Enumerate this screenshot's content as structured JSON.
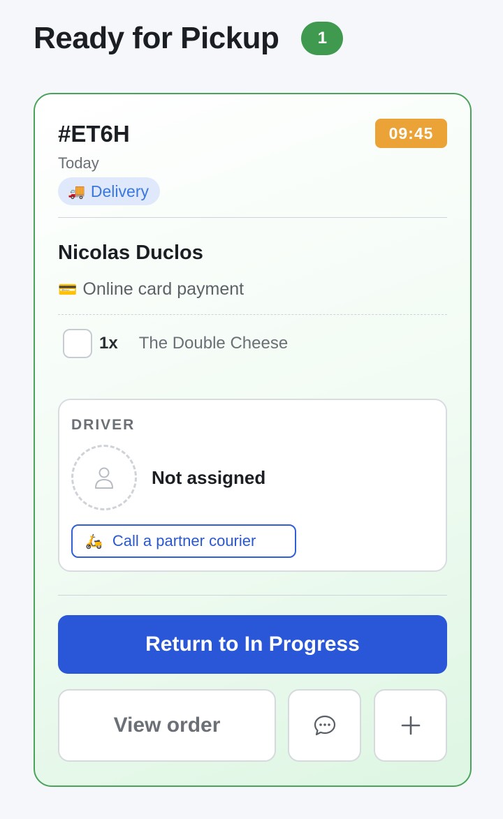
{
  "header": {
    "title": "Ready for Pickup",
    "count": "1"
  },
  "order": {
    "id": "#ET6H",
    "time": "09:45",
    "date": "Today",
    "type_label": "Delivery",
    "type_icon": "delivery-truck-icon",
    "customer_name": "Nicolas Duclos",
    "payment_label": "Online card payment",
    "payment_icon": "credit-card-icon",
    "items": [
      {
        "qty": "1x",
        "name": "The Double Cheese",
        "checked": false
      }
    ]
  },
  "driver": {
    "label": "DRIVER",
    "status": "Not assigned",
    "call_button": "Call a partner courier",
    "call_icon": "scooter-icon"
  },
  "actions": {
    "primary": "Return to In Progress",
    "view_order": "View order",
    "message_icon": "chat-bubble-icon",
    "add_icon": "plus-icon"
  },
  "colors": {
    "card_border": "#4ba35b",
    "count_badge": "#3f9a4f",
    "time_badge": "#eba338",
    "primary_button": "#2a56d8",
    "delivery_pill_bg": "#dfe9fb",
    "delivery_pill_text": "#3a77de"
  }
}
